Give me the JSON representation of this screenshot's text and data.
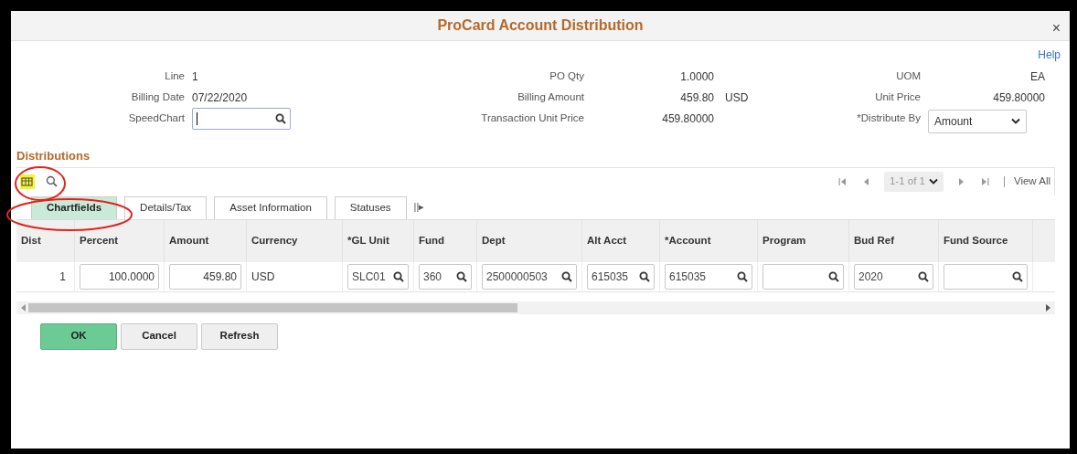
{
  "window": {
    "title": "ProCard Account Distribution",
    "close": "×"
  },
  "help": "Help",
  "header": {
    "left": [
      {
        "label": "Line",
        "value": "1",
        "kind": "text"
      },
      {
        "label": "Billing Date",
        "value": "07/22/2020",
        "kind": "text"
      },
      {
        "label": "SpeedChart",
        "kind": "lookup"
      }
    ],
    "middle": [
      {
        "label": "PO Qty",
        "value": "1.0000"
      },
      {
        "label": "Billing Amount",
        "value": "459.80",
        "unit": "USD"
      },
      {
        "label": "Transaction Unit Price",
        "value": "459.80000"
      }
    ],
    "right": [
      {
        "label": "UOM",
        "value": "EA",
        "kind": "text"
      },
      {
        "label": "Unit Price",
        "value": "459.80000",
        "kind": "text"
      },
      {
        "label": "*Distribute By",
        "value": "Amount",
        "kind": "select"
      }
    ]
  },
  "distributions": {
    "title": "Distributions",
    "pager": {
      "range": "1-1 of 1",
      "view_all": "View All"
    },
    "tabs": [
      {
        "label": "Chartfields",
        "selected": true
      },
      {
        "label": "Details/Tax",
        "selected": false
      },
      {
        "label": "Asset Information",
        "selected": false
      },
      {
        "label": "Statuses",
        "selected": false
      }
    ],
    "more_tabs": "||▸",
    "table": {
      "columns": [
        "Dist",
        "Percent",
        "Amount",
        "Currency",
        "*GL Unit",
        "Fund",
        "Dept",
        "Alt Acct",
        "*Account",
        "Program",
        "Bud Ref",
        "Fund Source"
      ],
      "rows": [
        [
          {
            "kind": "number",
            "value": "1"
          },
          {
            "kind": "input",
            "value": "100.0000"
          },
          {
            "kind": "input",
            "value": "459.80"
          },
          {
            "kind": "text",
            "value": "USD"
          },
          {
            "kind": "lookup",
            "value": "SLC01"
          },
          {
            "kind": "lookup",
            "value": "360"
          },
          {
            "kind": "lookup",
            "value": "2500000503"
          },
          {
            "kind": "lookup",
            "value": "615035"
          },
          {
            "kind": "lookup",
            "value": "615035"
          },
          {
            "kind": "lookup"
          },
          {
            "kind": "lookup",
            "value": "2020"
          },
          {
            "kind": "lookup"
          }
        ]
      ]
    }
  },
  "buttons": [
    {
      "label": "OK",
      "kind": "primary"
    },
    {
      "label": "Cancel",
      "kind": "secondary"
    },
    {
      "label": "Refresh",
      "kind": "secondary"
    }
  ]
}
